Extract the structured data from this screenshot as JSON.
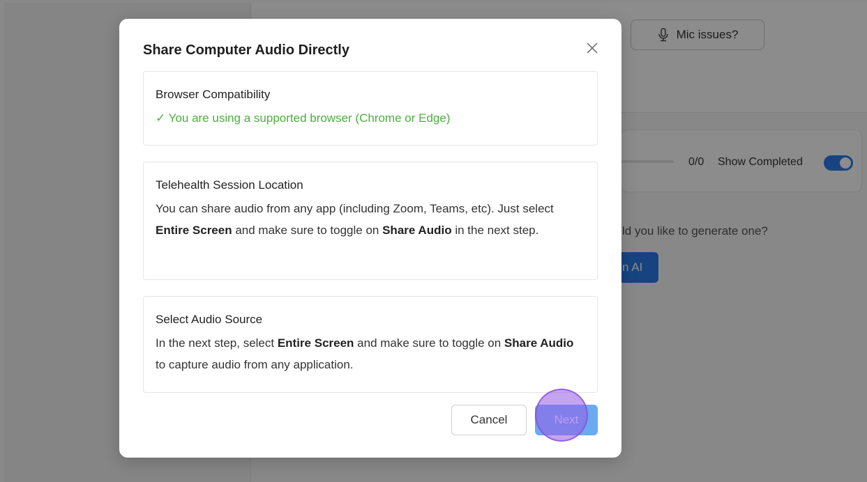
{
  "background": {
    "mic_button_label": "Mic issues?",
    "progress_count": "0/0",
    "show_completed_label": "Show Completed",
    "generate_prompt": "ld you like to generate one?",
    "ai_button_label": "n AI"
  },
  "modal": {
    "title": "Share Computer Audio Directly",
    "sections": [
      {
        "title": "Browser Compatibility",
        "status": "✓ You are using a supported browser (Chrome or Edge)"
      },
      {
        "title": "Telehealth Session Location",
        "body_1": "You can share audio from any app (including Zoom, Teams, etc). Just select ",
        "bold_1": "Entire Screen",
        "body_2": " and make sure to toggle on ",
        "bold_2": "Share Audio",
        "body_3": " in the next step."
      },
      {
        "title": "Select Audio Source",
        "body_1": "In the next step, select ",
        "bold_1": "Entire Screen",
        "body_2": " and make sure to toggle on ",
        "bold_2": "Share Audio",
        "body_3": " to capture audio from any application."
      }
    ],
    "cancel_label": "Cancel",
    "next_label": "Next"
  },
  "colors": {
    "accent": "#2b7de9",
    "success": "#4caf3d",
    "next_button": "#6aaaf0",
    "click_indicator": "#965ae6"
  }
}
